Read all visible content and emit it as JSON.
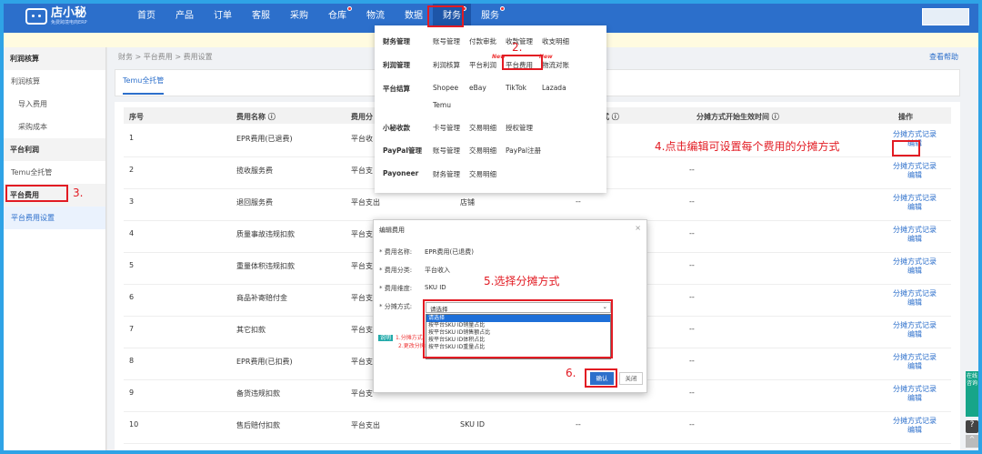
{
  "logo": {
    "name": "店小秘",
    "sub": "免费跨境电商ERP"
  },
  "menu": [
    "首页",
    "产品",
    "订单",
    "客服",
    "采购",
    "仓库",
    "物流",
    "数据",
    "财务",
    "服务"
  ],
  "sidebar": {
    "g1": "利润核算",
    "g1_items": [
      "利润核算",
      "导入费用",
      "采购成本"
    ],
    "g2": "平台利润",
    "g2_items": [
      "Temu全托管"
    ],
    "g3": "平台费用",
    "g3_items": [
      "平台费用设置"
    ]
  },
  "crumb": "财务 > 平台费用 > 费用设置",
  "help": "查看帮助",
  "tab": "Temu全托管",
  "table": {
    "headers": [
      "序号",
      "费用名称 ⓘ",
      "费用分",
      "式 ⓘ",
      "分摊方式开始生效时间 ⓘ",
      "操作"
    ],
    "action1": "分摊方式记录",
    "action2": "编辑",
    "rows": [
      {
        "no": "1",
        "name": "EPR费用(已退费)",
        "type": "平台收",
        "dim": "",
        "m": "",
        "t": ""
      },
      {
        "no": "2",
        "name": "揽收服务费",
        "type": "平台支",
        "dim": "",
        "m": "",
        "t": "--"
      },
      {
        "no": "3",
        "name": "退回服务费",
        "type": "平台支出",
        "dim": "店铺",
        "m": "--",
        "t": "--"
      },
      {
        "no": "4",
        "name": "质量事故违规扣款",
        "type": "平台支",
        "dim": "",
        "m": "",
        "t": "--"
      },
      {
        "no": "5",
        "name": "重量体积违规扣款",
        "type": "平台支",
        "dim": "",
        "m": "",
        "t": "--"
      },
      {
        "no": "6",
        "name": "商品补寄赔付金",
        "type": "平台支",
        "dim": "",
        "m": "",
        "t": "--"
      },
      {
        "no": "7",
        "name": "其它扣款",
        "type": "平台支",
        "dim": "",
        "m": "",
        "t": "--"
      },
      {
        "no": "8",
        "name": "EPR费用(已扣费)",
        "type": "平台支",
        "dim": "",
        "m": "",
        "t": "--"
      },
      {
        "no": "9",
        "name": "备货违规扣款",
        "type": "平台支",
        "dim": "",
        "m": "",
        "t": "--"
      },
      {
        "no": "10",
        "name": "售后赔付扣款",
        "type": "平台支出",
        "dim": "SKU ID",
        "m": "--",
        "t": "--"
      }
    ]
  },
  "dropdown": {
    "r1": {
      "head": "财务管理",
      "links": [
        "账号管理",
        "付款审批",
        "收款管理",
        "收支明细"
      ]
    },
    "r2": {
      "head": "利润管理",
      "links": [
        "利润核算",
        "平台利润",
        "平台费用",
        "物流对账"
      ]
    },
    "r3": {
      "head": "平台结算",
      "links": [
        "Shopee",
        "eBay",
        "TikTok",
        "Lazada",
        "Temu"
      ]
    },
    "r4": {
      "head": "小秘收款",
      "links": [
        "卡号管理",
        "交易明细",
        "授权管理"
      ]
    },
    "r5": {
      "head": "PayPal管理",
      "links": [
        "账号管理",
        "交易明细",
        "PayPal注册"
      ]
    },
    "r6": {
      "head": "Payoneer",
      "links": [
        "财务管理",
        "交易明细"
      ]
    },
    "new": "New"
  },
  "modal": {
    "title": "编辑费用",
    "close": "×",
    "l1": "* 费用名称:",
    "v1": "EPR费用(已退费)",
    "l2": "* 费用分类:",
    "v2": "平台收入",
    "l3": "* 费用维度:",
    "v3": "SKU ID",
    "l4": "* 分摊方式:",
    "select": "请选择",
    "options": [
      "请选择",
      "按平台SKU ID销量占比",
      "按平台SKU ID销售额占比",
      "按平台SKU ID体积占比",
      "按平台SKU ID重量占比"
    ],
    "badge": "说明",
    "exp1": "1.分摊方式",
    "exp2": "2.更改分摊",
    "ok": "确认",
    "cancel": "关闭"
  },
  "annotations": {
    "a2": "2.",
    "a3": "3.",
    "a4": "4.点击编辑可设置每个费用的分摊方式",
    "a5": "5.选择分摊方式",
    "a6": "6."
  },
  "tools": {
    "green": "在线咨询",
    "q": "?",
    "up": "^"
  }
}
